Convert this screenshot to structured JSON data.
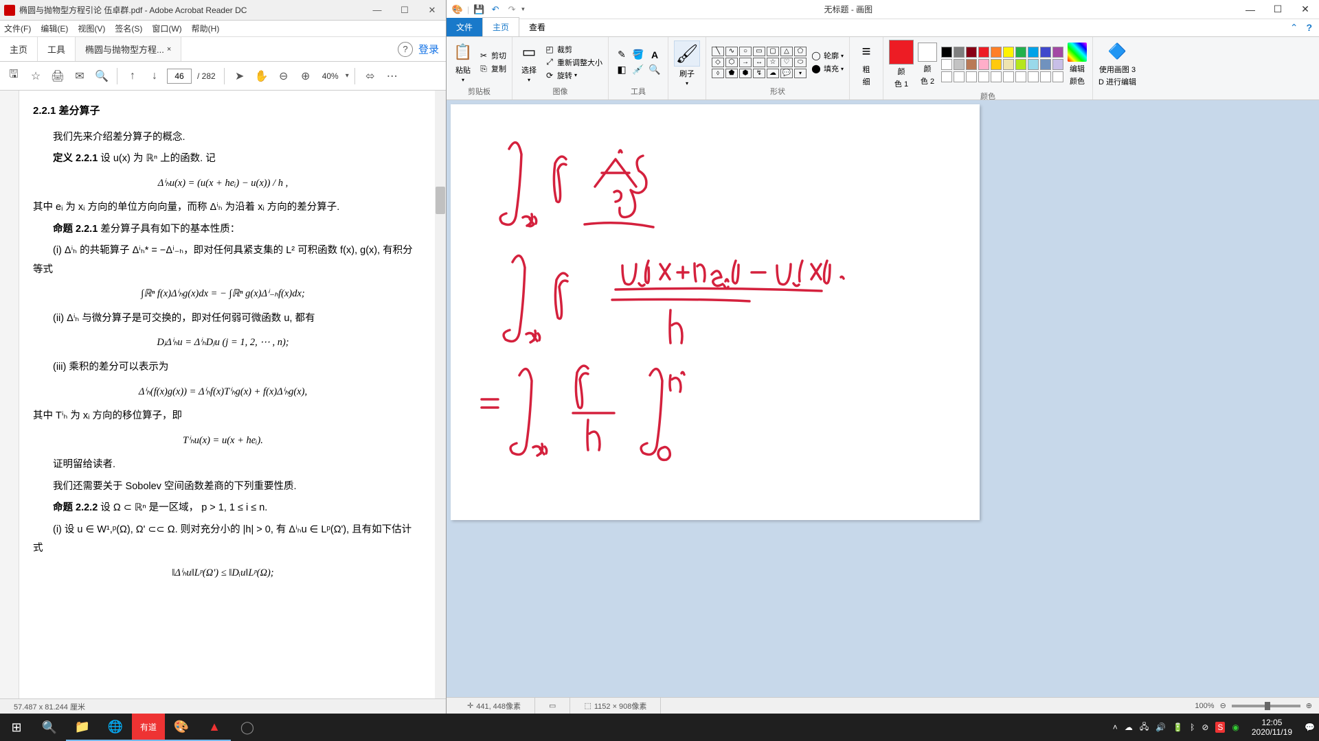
{
  "acrobat": {
    "title": "椭圆与抛物型方程引论 伍卓群.pdf - Adobe Acrobat Reader DC",
    "tab_doc": "椭圆与抛物型方程...",
    "menu": {
      "file": "文件(F)",
      "edit": "编辑(E)",
      "view": "视图(V)",
      "sign": "签名(S)",
      "window": "窗口(W)",
      "help": "帮助(H)"
    },
    "tabs": {
      "home": "主页",
      "tools": "工具",
      "login": "登录"
    },
    "toolbar": {
      "page_current": "46",
      "page_total": "/ 282",
      "zoom": "40%"
    },
    "status": {
      "coords": "57.487 x 81.244 厘米"
    },
    "content": {
      "h1": "2.2.1  差分算子",
      "p1": "我们先来介绍差分算子的概念.",
      "p2_a": "定义 2.2.1",
      "p2_b": "   设 u(x) 为 ℝⁿ 上的函数.  记",
      "eq1": "Δⁱₕu(x) = (u(x + heᵢ) − u(x)) / h ,",
      "p3": "其中 eᵢ 为 xᵢ 方向的单位方向向量，而称 Δⁱₕ 为沿着 xᵢ 方向的差分算子.",
      "p4_a": "命题 2.2.1",
      "p4_b": "   差分算子具有如下的基本性质：",
      "p5": "(i) Δⁱₕ 的共轭算子 Δⁱₕ* = −Δⁱ₋ₕ，即对任何具紧支集的 L² 可积函数 f(x), g(x), 有积分等式",
      "eq2": "∫ℝⁿ f(x)Δⁱₕg(x)dx = − ∫ℝⁿ g(x)Δⁱ₋ₕf(x)dx;",
      "p6": "(ii) Δⁱₕ 与微分算子是可交换的，即对任何弱可微函数 u, 都有",
      "eq3": "DⱼΔⁱₕu = ΔⁱₕDⱼu   (j = 1, 2, ⋯ , n);",
      "p7": "(iii) 乘积的差分可以表示为",
      "eq4": "Δⁱₕ(f(x)g(x)) = Δⁱₕf(x)Tⁱₕg(x) + f(x)Δⁱₕg(x),",
      "p8": "其中 Tⁱₕ 为 xᵢ 方向的移位算子，即",
      "eq5": "Tⁱₕu(x) = u(x + heᵢ).",
      "p9": "证明留给读者.",
      "p10": "我们还需要关于 Sobolev 空间函数差商的下列重要性质.",
      "p11_a": "命题 2.2.2",
      "p11_b": "   设 Ω ⊂ ℝⁿ 是一区域， p > 1, 1 ≤ i ≤ n.",
      "p12": "(i) 设 u ∈ W¹,ᵖ(Ω), Ω' ⊂⊂ Ω.  则对充分小的 |h| > 0, 有 Δⁱₕu ∈ Lᵖ(Ω'),  且有如下估计式",
      "eq6": "‖Δⁱₕu‖Lᵖ(Ω') ≤ ‖Dᵢu‖Lᵖ(Ω);"
    }
  },
  "paint": {
    "title": "无标题 - 画图",
    "tabs": {
      "file": "文件",
      "home": "主页",
      "view": "查看"
    },
    "ribbon": {
      "clipboard": {
        "paste": "粘贴",
        "cut": "剪切",
        "copy": "复制",
        "label": "剪贴板"
      },
      "image": {
        "select": "选择",
        "crop": "裁剪",
        "resize": "重新调整大小",
        "rotate": "旋转",
        "label": "图像"
      },
      "tools_label": "工具",
      "brush": "刷子",
      "shapes": {
        "outline": "轮廓",
        "fill": "填充",
        "label": "形状"
      },
      "stroke": {
        "label1": "粗",
        "label2": "细"
      },
      "color1": {
        "l1": "颜",
        "l2": "色 1"
      },
      "color2": {
        "l1": "颜",
        "l2": "色 2"
      },
      "colors_label": "颜色",
      "edit_colors": {
        "l1": "编辑",
        "l2": "颜色"
      },
      "paint3d": {
        "l1": "使用画图 3",
        "l2": "D 进行编辑"
      }
    },
    "status": {
      "pos": "441, 448像素",
      "size": "1152 × 908像素",
      "zoom": "100%"
    },
    "palette_hex": [
      "#000000",
      "#7f7f7f",
      "#880015",
      "#ed1c24",
      "#ff7f27",
      "#fff200",
      "#22b14c",
      "#00a2e8",
      "#3f48cc",
      "#a349a4",
      "#ffffff",
      "#c3c3c3",
      "#b97a57",
      "#ffaec9",
      "#ffc90e",
      "#efe4b0",
      "#b5e61d",
      "#99d9ea",
      "#7092be",
      "#c8bfe7",
      "#ffffff",
      "#ffffff",
      "#ffffff",
      "#ffffff",
      "#ffffff",
      "#ffffff",
      "#ffffff",
      "#ffffff",
      "#ffffff",
      "#ffffff"
    ],
    "selected_color1": "#ed1c24",
    "selected_color2": "#ffffff"
  },
  "taskbar": {
    "time": "12:05",
    "date": "2020/11/19"
  }
}
